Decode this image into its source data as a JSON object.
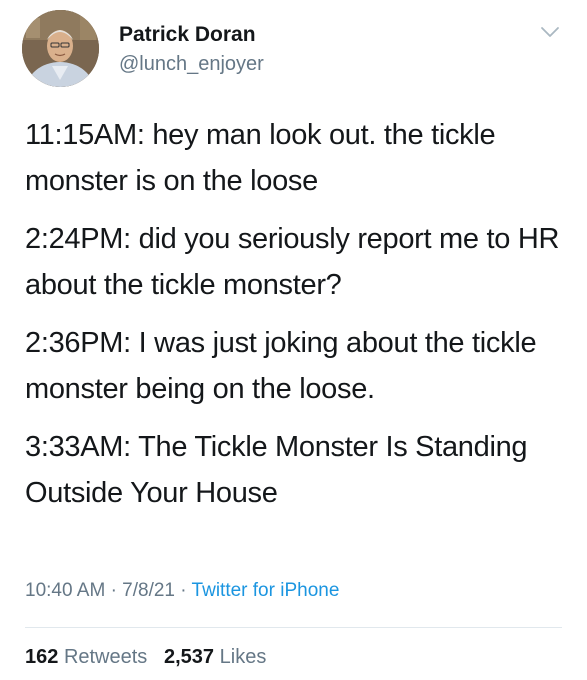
{
  "user": {
    "name": "Patrick Doran",
    "handle": "@lunch_enjoyer"
  },
  "tweet": {
    "lines": [
      "11:15AM: hey man look out. the tickle monster is on the loose",
      "2:24PM: did you seriously report me to HR about the tickle monster?",
      "2:36PM: I was just joking about the tickle monster being on the loose.",
      "3:33AM: The Tickle Monster Is Standing Outside Your House"
    ]
  },
  "meta": {
    "time": "10:40 AM",
    "separator": "·",
    "date": "7/8/21",
    "source": "Twitter for iPhone"
  },
  "stats": {
    "retweets_count": "162",
    "retweets_label": "Retweets",
    "likes_count": "2,537",
    "likes_label": "Likes"
  },
  "icons": {
    "menu": "chevron-down-icon"
  },
  "colors": {
    "text": "#14171a",
    "secondary": "#657786",
    "link": "#1b95e0",
    "divider": "#e1e8ed"
  }
}
